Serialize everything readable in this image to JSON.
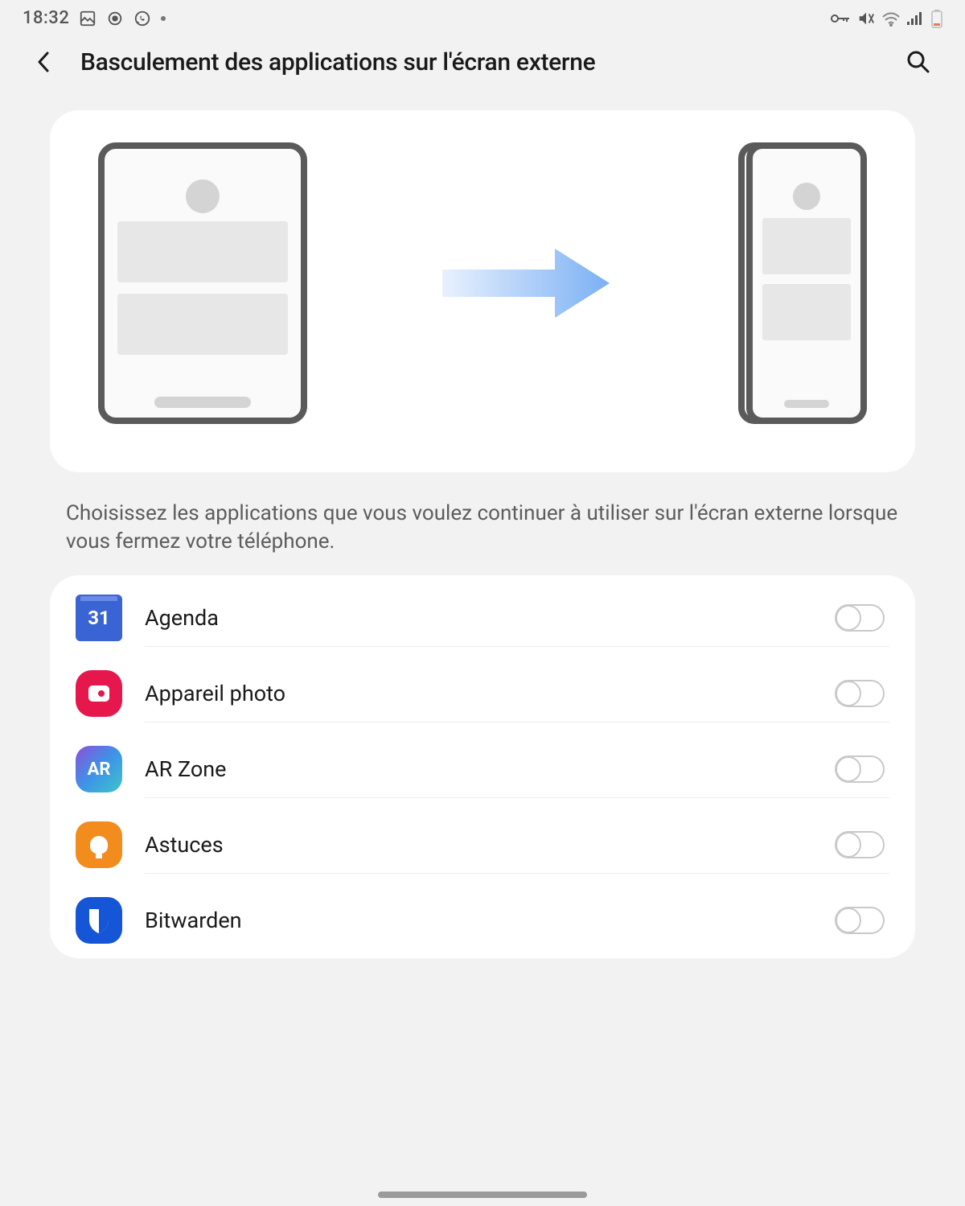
{
  "status": {
    "time": "18:32"
  },
  "header": {
    "title": "Basculement des applications sur l'écran externe"
  },
  "description": "Choisissez les applications que vous voulez continuer à utiliser sur l'écran externe lorsque vous fermez votre téléphone.",
  "apps": [
    {
      "name": "Agenda",
      "icon_text": "31",
      "enabled": false
    },
    {
      "name": "Appareil photo",
      "icon_text": "",
      "enabled": false
    },
    {
      "name": "AR Zone",
      "icon_text": "AR",
      "enabled": false
    },
    {
      "name": "Astuces",
      "icon_text": "",
      "enabled": false
    },
    {
      "name": "Bitwarden",
      "icon_text": "",
      "enabled": false
    }
  ]
}
